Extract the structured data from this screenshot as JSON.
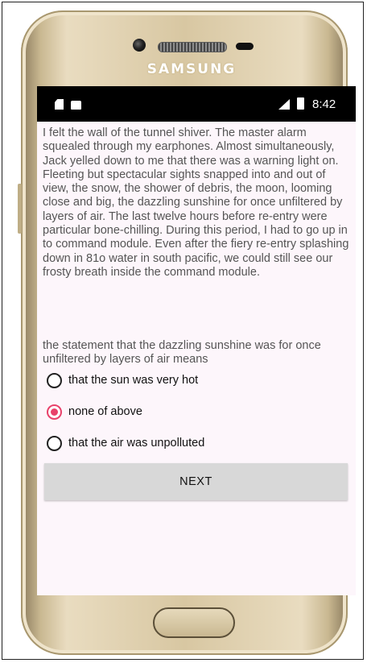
{
  "device": {
    "brand": "SAMSUNG"
  },
  "status_bar": {
    "time": "8:42",
    "icons": [
      "sim-icon",
      "android-icon",
      "signal-icon",
      "battery-icon"
    ]
  },
  "quiz": {
    "passage": "I felt the wall of the tunnel shiver. The master alarm squealed through my earphones. Almost simultaneously, Jack yelled down to me that there was a warning light on. Fleeting but spectacular sights snapped into and out of view, the snow, the shower of debris, the moon, looming close and big, the dazzling sunshine for once unfiltered by layers of air. The last twelve hours before re-entry were particular bone-chilling. During this period, I had to go up in to command module. Even after the fiery re-entry splashing down in 81o water in south pacific, we could still see our frosty breath inside the command module.",
    "question": "the statement that the dazzling sunshine was for once unfiltered by layers of air means",
    "options": [
      {
        "label": "that the sun was very hot",
        "selected": false
      },
      {
        "label": "none of above",
        "selected": true
      },
      {
        "label": "that the air was unpolluted",
        "selected": false
      }
    ],
    "next_label": "NEXT"
  },
  "colors": {
    "accent": "#e8416a",
    "screen_background": "#fdf6fb",
    "button_background": "#d8d8d8",
    "status_bar": "#000000"
  }
}
